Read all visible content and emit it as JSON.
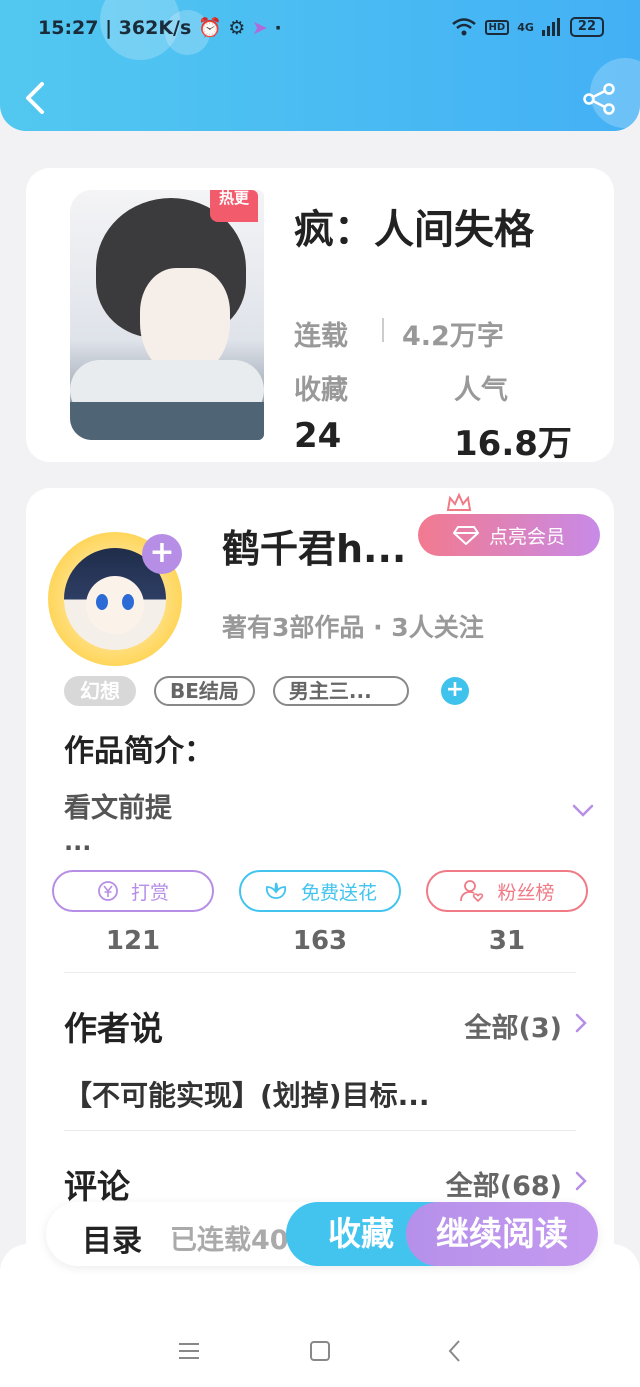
{
  "status_bar": {
    "time": "15:27",
    "speed": "362K/s",
    "network": "4G",
    "hd": "HD",
    "battery": "22"
  },
  "book": {
    "hot_tag": "热更",
    "title": "疯：人间失格",
    "status": "连载",
    "word_count": "4.2万字",
    "favorites_label": "收藏",
    "favorites_value": "24",
    "popularity_label": "人气",
    "popularity_value": "16.8万"
  },
  "author": {
    "name": "鹤千君h...",
    "vip_button": "点亮会员",
    "meta": "著有3部作品 · 3人关注",
    "tags": [
      "幻想",
      "BE结局",
      "男主三..."
    ]
  },
  "intro": {
    "title": "作品简介：",
    "text": "看文前提",
    "more": "..."
  },
  "actions": [
    {
      "label": "打赏",
      "count": "121",
      "color": "#b78ee6"
    },
    {
      "label": "免费送花",
      "count": "163",
      "color": "#43c4ef"
    },
    {
      "label": "粉丝榜",
      "count": "31",
      "color": "#f07a86"
    }
  ],
  "author_says": {
    "title": "作者说",
    "all": "全部(3)",
    "text": "【不可能实现】(划掉)目标..."
  },
  "comments": {
    "title": "评论",
    "all": "全部(68)"
  },
  "bottom": {
    "toc": "目录",
    "serial": "已连载40",
    "collect": "收藏",
    "read": "继续阅读"
  },
  "colors": {
    "header": "#43b0f5",
    "accent_purple": "#b78ee6",
    "accent_blue": "#43c4ef"
  }
}
